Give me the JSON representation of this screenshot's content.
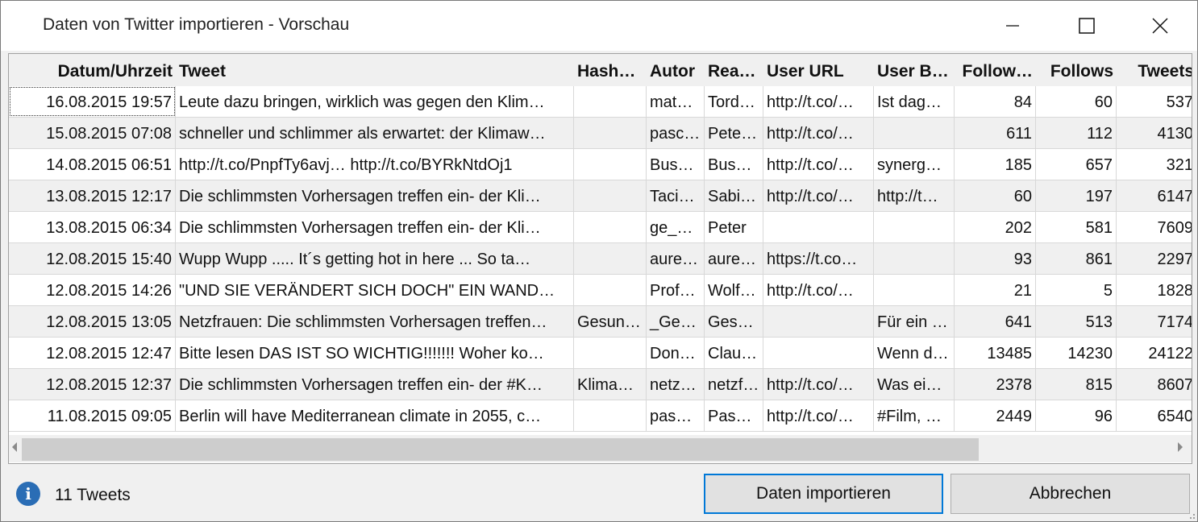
{
  "window": {
    "title": "Daten von Twitter importieren - Vorschau"
  },
  "grid": {
    "columns": [
      "Datum/Uhrzeit",
      "Tweet",
      "Hash…",
      "Autor",
      "Rea…",
      "User URL",
      "User B…",
      "Follow…",
      "Follows",
      "Tweets"
    ],
    "rows": [
      [
        "16.08.2015 19:57",
        "Leute dazu bringen, wirklich was gegen den Klim…",
        "",
        "mat…",
        "Tord…",
        "http://t.co/…",
        "Ist dag…",
        "84",
        "60",
        "537"
      ],
      [
        "15.08.2015 07:08",
        "schneller und schlimmer als erwartet: der Klimaw…",
        "",
        "pasc…",
        "Pete…",
        "http://t.co/…",
        "",
        "611",
        "112",
        "4130"
      ],
      [
        "14.08.2015 06:51",
        "http://t.co/PnpfTy6avj… http://t.co/BYRkNtdOj1",
        "",
        "Busc…",
        "Busc…",
        "http://t.co/…",
        "synerge…",
        "185",
        "657",
        "321"
      ],
      [
        "13.08.2015 12:17",
        "Die schlimmsten Vorhersagen treffen ein- der Kli…",
        "",
        "Taci…",
        "Sabi…",
        "http://t.co/…",
        "http://t…",
        "60",
        "197",
        "6147"
      ],
      [
        "13.08.2015 06:34",
        "Die schlimmsten Vorhersagen treffen ein- der Kli…",
        "",
        "ge_…",
        "Peter",
        "",
        "",
        "202",
        "581",
        "7609"
      ],
      [
        "12.08.2015 15:40",
        "Wupp Wupp ..... It´s getting hot in here ... So ta…",
        "",
        "aure…",
        "aure…",
        "https://t.co…",
        "",
        "93",
        "861",
        "2297"
      ],
      [
        "12.08.2015 14:26",
        "\"UND SIE VERÄNDERT SICH DOCH\" EIN WAND…",
        "",
        "Prof…",
        "Wolf…",
        "http://t.co/…",
        "",
        "21",
        "5",
        "1828"
      ],
      [
        "12.08.2015 13:05",
        "Netzfrauen: Die schlimmsten Vorhersagen treffen…",
        "Gesun…",
        "_Ges…",
        "Gesu…",
        "",
        "Für ein …",
        "641",
        "513",
        "7174"
      ],
      [
        "12.08.2015 12:47",
        "Bitte lesen DAS IST SO WICHTIG!!!!!!! Woher ko…",
        "",
        "Don…",
        "Clau…",
        "",
        "Wenn d…",
        "13485",
        "14230",
        "24122"
      ],
      [
        "12.08.2015 12:37",
        "Die schlimmsten Vorhersagen treffen ein- der #K…",
        "Klima…",
        "netz…",
        "netzf…",
        "http://t.co/…",
        "Was ei…",
        "2378",
        "815",
        "8607"
      ],
      [
        "11.08.2015 09:05",
        "Berlin will have Mediterranean climate in 2055, c…",
        "",
        "pash…",
        "Pash…",
        "http://t.co/…",
        "#Film, …",
        "2449",
        "96",
        "6540"
      ]
    ]
  },
  "footer": {
    "info_icon": "info-icon",
    "count_text": "11 Tweets",
    "import_label": "Daten importieren",
    "cancel_label": "Abbrechen"
  }
}
